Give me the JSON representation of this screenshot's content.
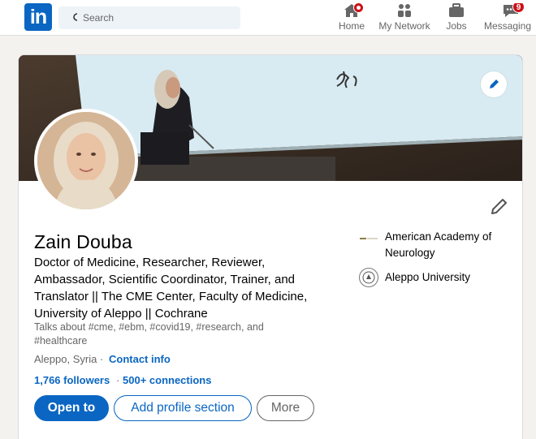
{
  "nav": {
    "logo_text": "in",
    "search": {
      "placeholder": "Search"
    },
    "items": [
      {
        "label": "Home",
        "icon": "home-icon",
        "badge": ""
      },
      {
        "label": "My Network",
        "icon": "network-icon",
        "badge": ""
      },
      {
        "label": "Jobs",
        "icon": "briefcase-icon",
        "badge": ""
      },
      {
        "label": "Messaging",
        "icon": "message-icon",
        "badge": "9"
      }
    ]
  },
  "profile": {
    "name": "Zain Douba",
    "headline": "Doctor of Medicine, Researcher, Reviewer, Ambassador, Scientific Coordinator, Trainer, and Translator || The CME Center, Faculty of Medicine, University of Aleppo || Cochrane",
    "talks_about": "Talks about #cme, #ebm, #covid19, #research, and #healthcare",
    "location": "Aleppo, Syria",
    "separator": "·",
    "contact_info": "Contact info",
    "followers": "1,766 followers",
    "dot": "·",
    "connections": "500+ connections",
    "buttons": {
      "open_to": "Open to",
      "add_section": "Add profile section",
      "more": "More"
    },
    "organizations": [
      {
        "name": "American Academy of Neurology"
      },
      {
        "name": "Aleppo University"
      }
    ]
  },
  "colors": {
    "brand": "#0a66c2",
    "badge": "#cc1016",
    "page_bg": "#f3f2ef"
  }
}
